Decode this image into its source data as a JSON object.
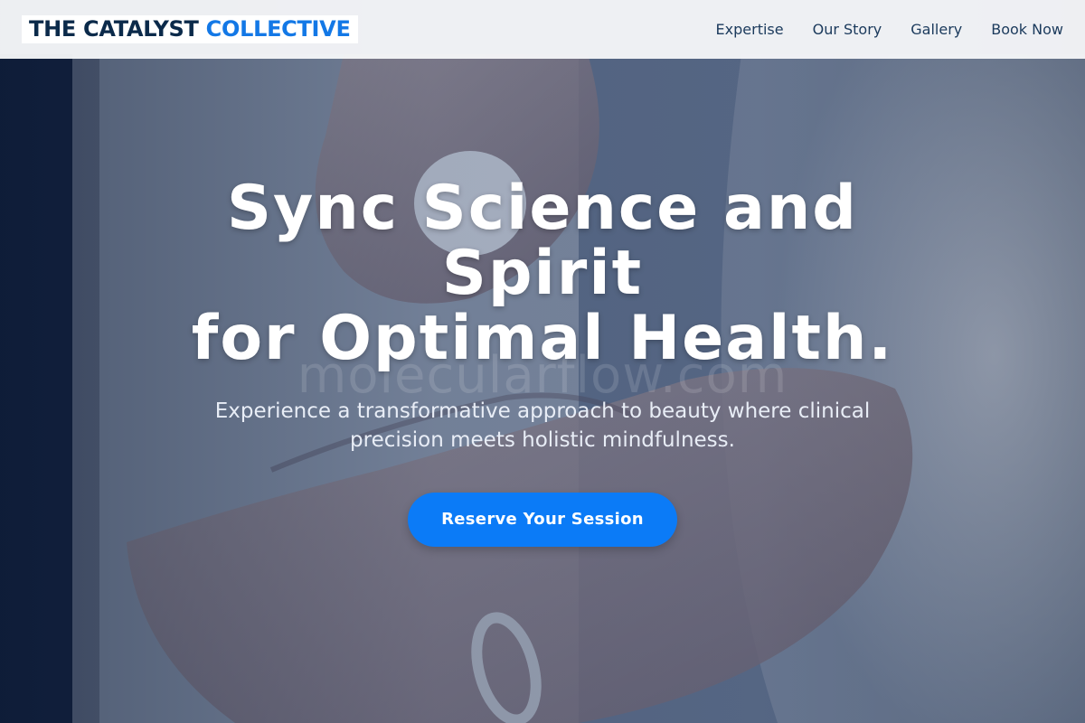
{
  "brand": {
    "name_part1": "THE CATALYST",
    "name_part2": "COLLECTIVE",
    "colors": {
      "dark": "#0b2a4a",
      "accent": "#1378e6"
    }
  },
  "nav": {
    "items": [
      {
        "label": "Expertise"
      },
      {
        "label": "Our Story"
      },
      {
        "label": "Gallery"
      },
      {
        "label": "Book Now"
      }
    ]
  },
  "hero": {
    "headline_line1": "Sync Science and",
    "headline_line2": "Spirit",
    "headline_line3": "for Optimal Health.",
    "watermark": "molecularflow.com",
    "subtitle": "Experience a transformative approach to beauty where clinical precision meets holistic mindfulness.",
    "cta_label": "Reserve Your Session",
    "cta_color": "#0b7bf7"
  }
}
